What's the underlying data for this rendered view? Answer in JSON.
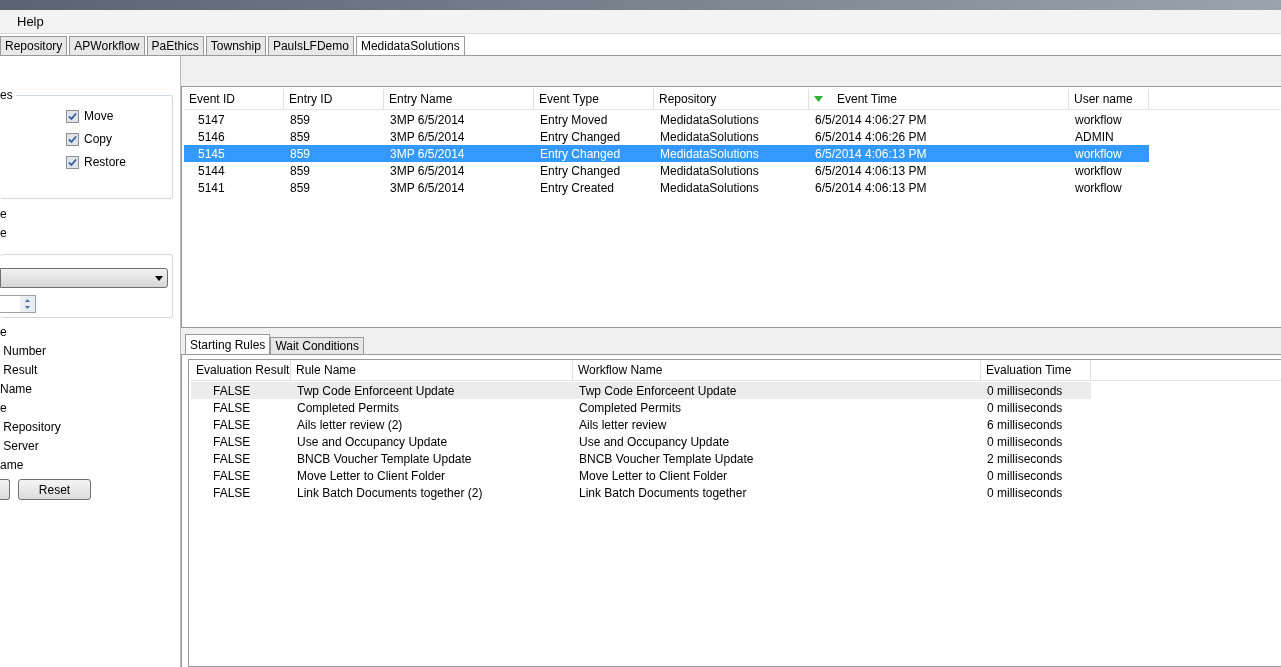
{
  "menu": [
    "Help"
  ],
  "repo_tabs": [
    {
      "label": "Repository",
      "selected": false
    },
    {
      "label": "APWorkflow",
      "selected": false
    },
    {
      "label": "PaEthics",
      "selected": false
    },
    {
      "label": "Township",
      "selected": false
    },
    {
      "label": "PaulsLFDemo",
      "selected": false
    },
    {
      "label": "MedidataSolutions",
      "selected": true
    }
  ],
  "filter_panel": {
    "group_title": "es",
    "checkboxes": [
      {
        "label": "Move",
        "checked": true
      },
      {
        "label": "Copy",
        "checked": true
      },
      {
        "label": "Restore",
        "checked": true
      }
    ],
    "labels_1": [
      "e",
      "e"
    ],
    "labels_2": [
      "e",
      " Number",
      " Result",
      "Name",
      "e",
      " Repository",
      " Server",
      "ame"
    ],
    "buttons": [
      "Reset"
    ]
  },
  "events": {
    "columns": [
      {
        "label": "Event ID",
        "sorted": false
      },
      {
        "label": "Entry ID",
        "sorted": false
      },
      {
        "label": "Entry Name",
        "sorted": false
      },
      {
        "label": "Event Type",
        "sorted": false
      },
      {
        "label": "Repository",
        "sorted": false
      },
      {
        "label": "Event Time",
        "sorted": true
      },
      {
        "label": "User name",
        "sorted": false
      }
    ],
    "rows": [
      {
        "cells": [
          "5147",
          "859",
          "3MP 6/5/2014",
          "Entry Moved",
          "MedidataSolutions",
          "6/5/2014 4:06:27 PM",
          "workflow"
        ],
        "selected": false
      },
      {
        "cells": [
          "5146",
          "859",
          "3MP 6/5/2014",
          "Entry Changed",
          "MedidataSolutions",
          "6/5/2014 4:06:26 PM",
          "ADMIN"
        ],
        "selected": false
      },
      {
        "cells": [
          "5145",
          "859",
          "3MP 6/5/2014",
          "Entry Changed",
          "MedidataSolutions",
          "6/5/2014 4:06:13 PM",
          "workflow"
        ],
        "selected": true
      },
      {
        "cells": [
          "5144",
          "859",
          "3MP 6/5/2014",
          "Entry Changed",
          "MedidataSolutions",
          "6/5/2014 4:06:13 PM",
          "workflow"
        ],
        "selected": false
      },
      {
        "cells": [
          "5141",
          "859",
          "3MP 6/5/2014",
          "Entry Created",
          "MedidataSolutions",
          "6/5/2014 4:06:13 PM",
          "workflow"
        ],
        "selected": false
      }
    ]
  },
  "detail_tabs": [
    {
      "label": "Starting Rules",
      "selected": true
    },
    {
      "label": "Wait Conditions",
      "selected": false
    }
  ],
  "rules": {
    "columns": [
      "Evaluation Result",
      "Rule Name",
      "Workflow Name",
      "Evaluation Time"
    ],
    "rows": [
      {
        "cells": [
          "FALSE",
          "Twp Code Enforceent Update",
          "Twp Code Enforceent Update",
          "0 milliseconds"
        ],
        "selected": true
      },
      {
        "cells": [
          "FALSE",
          "Completed Permits",
          "Completed Permits",
          "0 milliseconds"
        ],
        "selected": false
      },
      {
        "cells": [
          "FALSE",
          "Ails letter review (2)",
          "Ails letter review",
          "6 milliseconds"
        ],
        "selected": false
      },
      {
        "cells": [
          "FALSE",
          "Use and Occupancy Update",
          "Use and Occupancy Update",
          "0 milliseconds"
        ],
        "selected": false
      },
      {
        "cells": [
          "FALSE",
          "BNCB Voucher Template Update",
          "BNCB Voucher Template Update",
          "2 milliseconds"
        ],
        "selected": false
      },
      {
        "cells": [
          "FALSE",
          "Move Letter to Client Folder",
          "Move Letter to Client Folder",
          "0 milliseconds"
        ],
        "selected": false
      },
      {
        "cells": [
          "FALSE",
          "Link Batch Documents together (2)",
          "Link Batch Documents together",
          "0 milliseconds"
        ],
        "selected": false
      }
    ]
  }
}
